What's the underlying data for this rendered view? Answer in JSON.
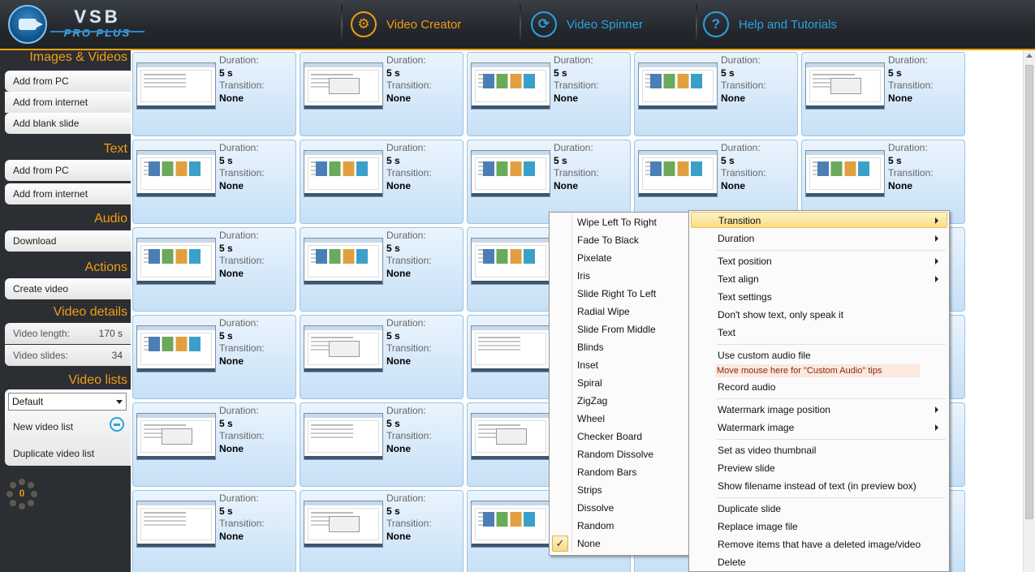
{
  "header": {
    "brand_top": "VSB",
    "brand_bottom": "PRO PLUS",
    "nav": [
      {
        "label": "Video Creator",
        "color": "#f39c12"
      },
      {
        "label": "Video Spinner",
        "color": "#2aa3e0"
      },
      {
        "label": "Help and Tutorials",
        "color": "#2aa3e0"
      }
    ]
  },
  "sidebar": {
    "images_videos": {
      "title": "Images & Videos",
      "buttons": [
        "Add from PC",
        "Add from internet",
        "Add blank slide"
      ]
    },
    "text": {
      "title": "Text",
      "buttons": [
        "Add from PC",
        "Add from internet"
      ]
    },
    "audio": {
      "title": "Audio",
      "buttons": [
        "Download"
      ]
    },
    "actions": {
      "title": "Actions",
      "buttons": [
        "Create video"
      ]
    },
    "video_details": {
      "title": "Video details",
      "length_label": "Video length:",
      "length_value": "170 s",
      "slides_label": "Video slides:",
      "slides_value": "34"
    },
    "video_lists": {
      "title": "Video lists",
      "selected": "Default",
      "buttons": [
        "New video list",
        "Duplicate video list"
      ]
    },
    "counter": "0"
  },
  "slide_labels": {
    "duration": "Duration:",
    "duration_value": "5 s",
    "transition": "Transition:",
    "transition_value": "None"
  },
  "transition_submenu": {
    "items": [
      "Wipe Left To Right",
      "Fade To Black",
      "Pixelate",
      "Iris",
      "Slide Right To Left",
      "Radial Wipe",
      "Slide From Middle",
      "Blinds",
      "Inset",
      "Spiral",
      "ZigZag",
      "Wheel",
      "Checker Board",
      "Random Dissolve",
      "Random Bars",
      "Strips",
      "Dissolve",
      "Random",
      "None"
    ],
    "checked": "None",
    "check_glyph": "✓"
  },
  "context_menu": {
    "transition": "Transition",
    "duration": "Duration",
    "text_position": "Text position",
    "text_align": "Text align",
    "text_settings": "Text settings",
    "dont_show_text": "Don't show text, only speak it",
    "text": "Text",
    "use_custom_audio": "Use custom audio file",
    "custom_audio_tip": "Move mouse here for \"Custom Audio\" tips",
    "record_audio": "Record audio",
    "watermark_position": "Watermark image position",
    "watermark_image": "Watermark image",
    "set_thumbnail": "Set as video thumbnail",
    "preview_slide": "Preview slide",
    "show_filename": "Show filename instead of text (in preview box)",
    "duplicate_slide": "Duplicate slide",
    "replace_image": "Replace image file",
    "remove_deleted": "Remove items that have a deleted image/video",
    "delete": "Delete"
  }
}
